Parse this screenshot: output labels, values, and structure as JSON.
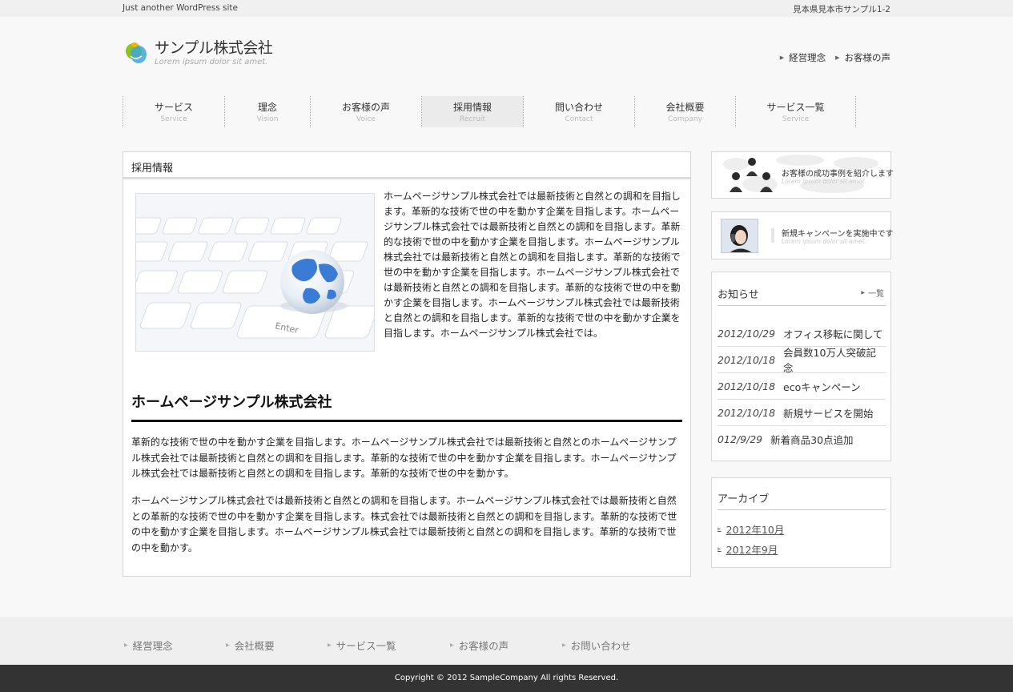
{
  "topbar": {
    "tagline": "Just another WordPress site",
    "address": "見本県見本市サンプル1-2"
  },
  "logo": {
    "title": "サンプル株式会社",
    "subtitle": "Lorem ipsum dolor sit amet."
  },
  "header_links": [
    "経営理念",
    "お客様の声"
  ],
  "gnav": [
    {
      "jp": "サービス",
      "en": "Service"
    },
    {
      "jp": "理念",
      "en": "Vision"
    },
    {
      "jp": "お客様の声",
      "en": "Voice"
    },
    {
      "jp": "採用情報",
      "en": "Recruit",
      "active": true
    },
    {
      "jp": "問い合わせ",
      "en": "Contact"
    },
    {
      "jp": "会社概要",
      "en": "Company"
    },
    {
      "jp": "サービス一覧",
      "en": "Service"
    }
  ],
  "main": {
    "title": "採用情報",
    "intro": "ホームページサンプル株式会社では最新技術と自然との調和を目指します。革新的な技術で世の中を動かす企業を目指します。ホームページサンプル株式会社では最新技術と自然との調和を目指します。革新的な技術で世の中を動かす企業を目指します。ホームページサンプル株式会社では最新技術と自然との調和を目指します。革新的な技術で世の中を動かす企業を目指します。ホームページサンプル株式会社では最新技術と自然との調和を目指します。革新的な技術で世の中を動かす企業を目指します。ホームページサンプル株式会社では最新技術と自然との調和を目指します。革新的な技術で世の中を動かす企業を目指します。ホームページサンプル株式会社では。",
    "heading": "ホームページサンプル株式会社",
    "paragraph1": "革新的な技術で世の中を動かす企業を目指します。ホームページサンプル株式会社では最新技術と自然とのホームページサンプル株式会社では最新技術と自然との調和を目指します。革新的な技術で世の中を動かす企業を目指します。ホームページサンプル株式会社では最新技術と自然との調和を目指します。革新的な技術で世の中を動かす。",
    "paragraph2": "ホームページサンプル株式会社では最新技術と自然との調和を目指します。ホームページサンプル株式会社では最新技術と自然との革新的な技術で世の中を動かす企業を目指します。株式会社では最新技術と自然との調和を目指します。革新的な技術で世の中を動かす企業を目指します。ホームページサンプル株式会社では最新技術と自然との調和を目指します。革新的な技術で世の中を動かす。",
    "keyboard_key": "Enter"
  },
  "banners": [
    {
      "title": "お客様の成功事例を紹介します",
      "subtitle": "Lorem ipsum dolor sit amet."
    },
    {
      "title": "新規キャンペーンを実施中です",
      "subtitle": "Lorem ipsum dolor sit amet."
    }
  ],
  "news": {
    "title": "お知らせ",
    "more": "一覧",
    "items": [
      {
        "date": "2012/10/29",
        "text": "オフィス移転に関して"
      },
      {
        "date": "2012/10/18",
        "text": "会員数10万人突破記念"
      },
      {
        "date": "2012/10/18",
        "text": "ecoキャンペーン"
      },
      {
        "date": "2012/10/18",
        "text": "新規サービスを開始"
      },
      {
        "date": "012/9/29",
        "text": "新着商品30点追加"
      }
    ]
  },
  "archive": {
    "title": "アーカイブ",
    "items": [
      "2012年10月",
      "2012年9月"
    ]
  },
  "footer_nav": [
    "経営理念",
    "会社概要",
    "サービス一覧",
    "お客様の声",
    "お問い合わせ"
  ],
  "copyright": "Copyright © 2012 SampleCompany All rights Reserved.",
  "colors": {
    "accent_blue": "#3a7bd5",
    "logo_green": "#8dc21f",
    "footer_dark": "#333333"
  }
}
